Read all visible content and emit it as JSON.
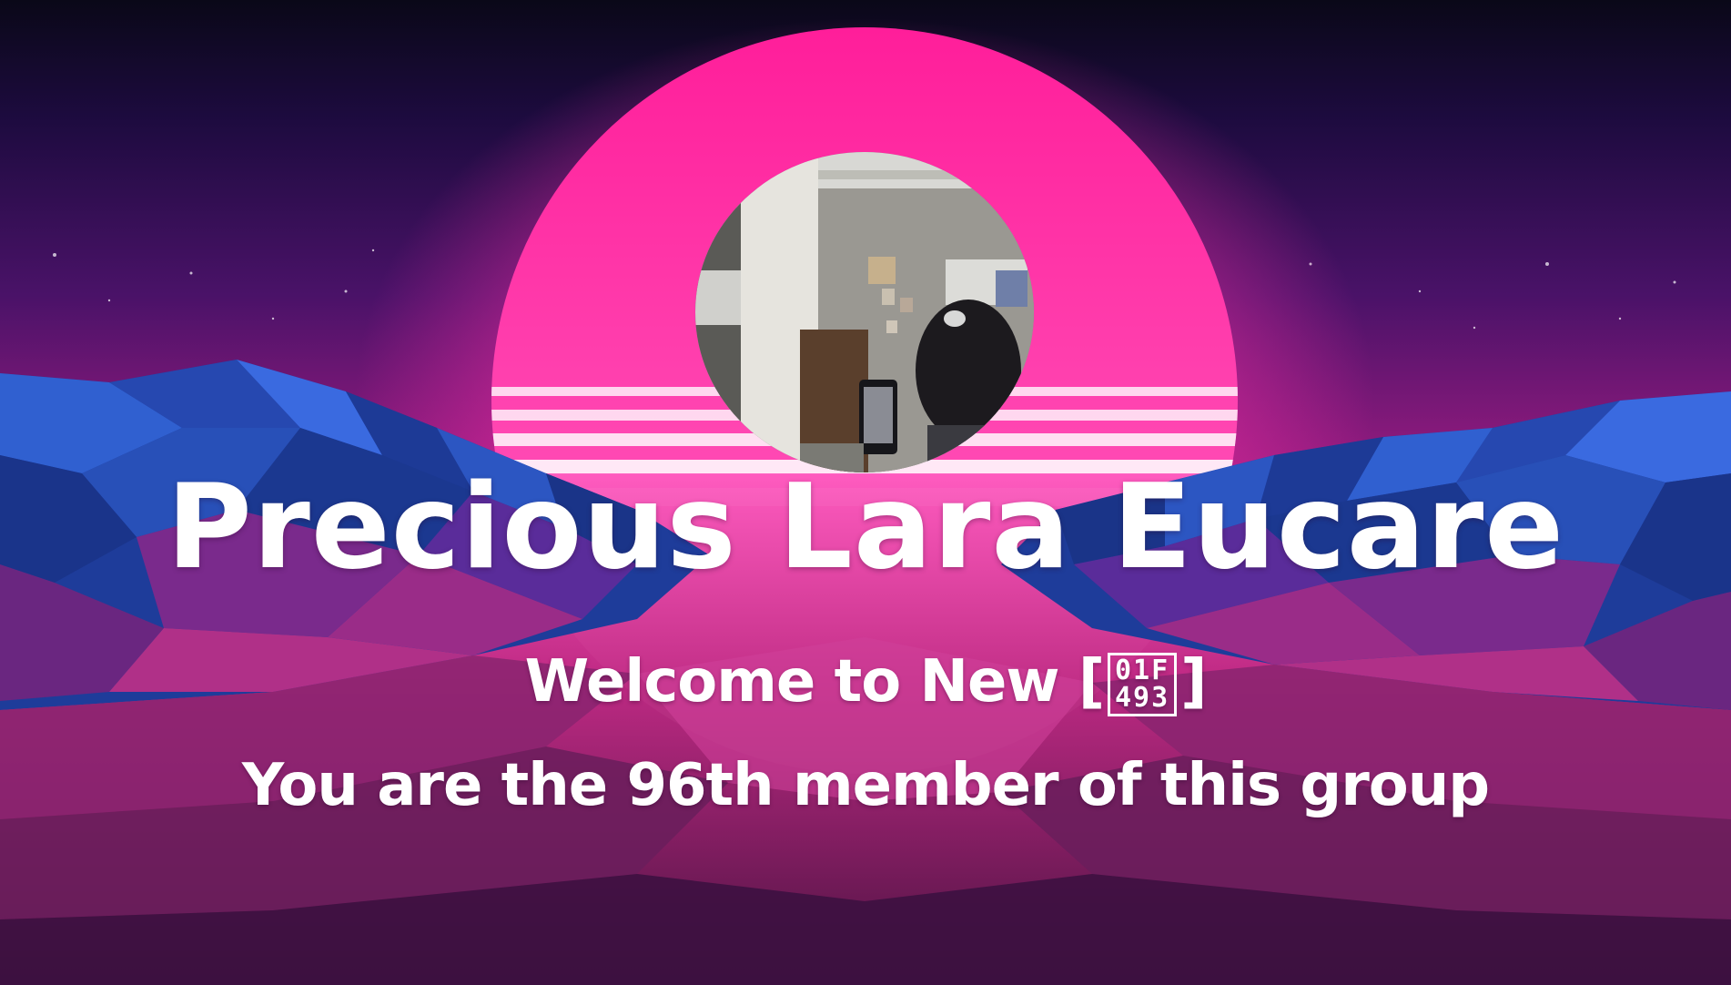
{
  "card": {
    "member_name": "Precious Lara Eucare",
    "welcome_prefix": "Welcome to New",
    "welcome_bracket_open": "[",
    "welcome_emoji_glyph": "01F493",
    "welcome_bracket_close": "]",
    "member_line": "You are the 96th member of this group"
  },
  "colors": {
    "sky_top": "#0c0820",
    "sky_mid": "#4a1268",
    "sun_pink": "#ff2fa8",
    "sun_core": "#ff9ad8",
    "mountain_blue": "#2a4fb0",
    "valley_pink": "#c23a8a",
    "text": "#ffffff"
  },
  "avatar": {
    "icon": "profile-photo"
  }
}
